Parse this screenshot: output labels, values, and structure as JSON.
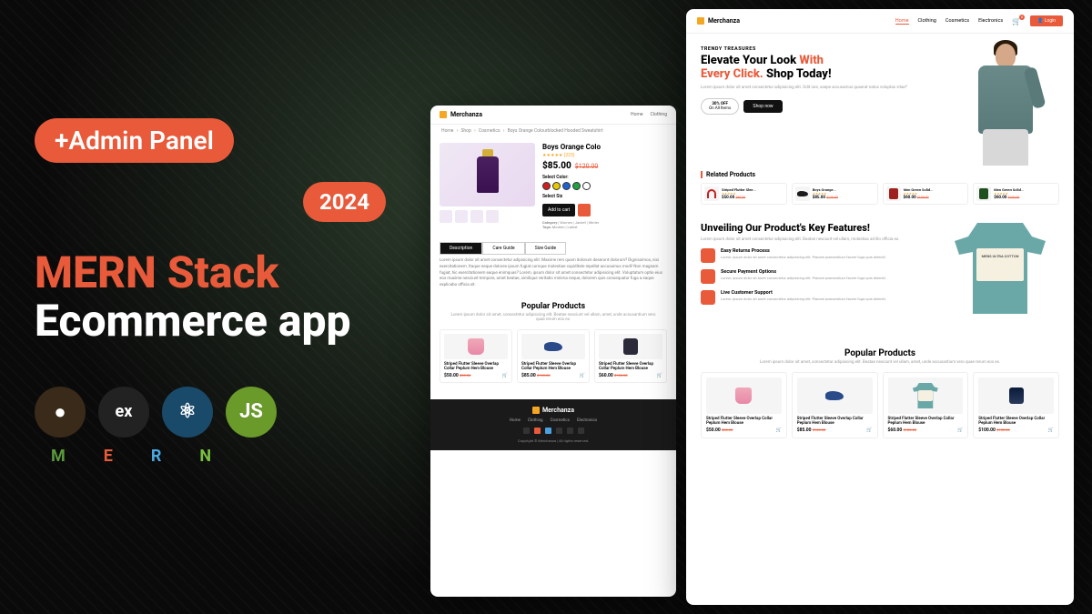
{
  "promo": {
    "admin_badge": "+Admin Panel",
    "year_badge": "2024",
    "title_stack": "MERN Stack",
    "title_app": "Ecommerce app",
    "tech": [
      "M",
      "E",
      "R",
      "N"
    ],
    "tech_labels": {
      "mongo": "",
      "exp": "ex",
      "react": "⚛",
      "node": "JS"
    }
  },
  "brand": "Merchanza",
  "nav_pd": [
    "Home",
    "Clothing"
  ],
  "nav_home": [
    "Home",
    "Clothing",
    "Cosmetics",
    "Electronics"
  ],
  "login_btn": "Login",
  "breadcrumb": [
    "Home",
    "Shop",
    "Cosmetics",
    "Boys Orange Colourblocked Hooded Sweatshirt"
  ],
  "product": {
    "title": "Boys Orange Colo",
    "rating_count": "(223)",
    "price": "$85.00",
    "old_price": "$120.00",
    "select_color": "Select Color:",
    "select_size": "Select Siz",
    "colors": [
      "#d02020",
      "#e6c800",
      "#2060d0",
      "#20a040",
      "#fff"
    ],
    "add_cart": "Add to cart",
    "category_lbl": "Category",
    "category_val": "| Women | Jacket | Winter",
    "tags_lbl": "Tags:",
    "tags_val": "Modern | Latest"
  },
  "tabs": [
    "Description",
    "Care Guide",
    "Size Guide"
  ],
  "description": "Lorem ipsum dolor sit amet consectetur adipisicing elit. Maxime rem quam dolorum deserunt dolorum? Dignissimos, nisi exercitationem. Itaque neque dolores ipsum fugiat cumque molestiae cupiditate repellat accusamus modi! Non magnam fugiat, hic exercitationem eaque enimquas?\nLorem, ipsum dolor sit amet consectetur adipisicing elit. Voluptatum optio eius eos maxime nesciunt tempore, amet beatae, similique veritatis minima neque, dolorem quis consequatur fuga a eaque explicabo officia sit.",
  "popular": {
    "title": "Popular Products",
    "subtitle": "Lorem ipsum dolor sit amet, consectetur adipisicing elit. Beatae nesciunt vel ullam, amet, unde accusantium vero quae rerum eos ex.",
    "items": [
      {
        "name": "Striped Flutter Sleeve Overlap Collar Peplum Hem Blouse",
        "price": "$50.00",
        "old": "$80.00"
      },
      {
        "name": "Striped Flutter Sleeve Overlap Collar Peplum Hem Blouse",
        "price": "$85.00",
        "old": "$120.00"
      },
      {
        "name": "Striped Flutter Sleeve Overlap Collar Peplum Hem Blouse",
        "price": "$60.00",
        "old": "$100.00"
      }
    ]
  },
  "footer": {
    "links": [
      "Home",
      "Clothing",
      "Cosmetics",
      "Electronics"
    ],
    "copyright": "Copyright © Merchanza | All rights reserved."
  },
  "hero": {
    "eyebrow": "TRENDY TREASURES",
    "line1a": "Elevate Your Look ",
    "line1b": "With",
    "line2a": "Every Click. ",
    "line2b": "Shop Today!",
    "subtitle": "Lorem ipsum dolor sit amet consectetur adipisicing elit. Odit iure, saepe accusamus quaerat natus voluptas vitae?",
    "off_pct": "30% OFF",
    "off_txt": "On All Items",
    "shop_btn": "Shop now"
  },
  "related": {
    "title": "Related Products",
    "items": [
      {
        "name": "Striped Flutter Slee...",
        "price": "$50.00",
        "old": "$80.00"
      },
      {
        "name": "Boys Orange...",
        "price": "$85.00",
        "old": "$120.00"
      },
      {
        "name": "Men Green Solid...",
        "price": "$60.00",
        "old": "$100.00"
      },
      {
        "name": "Men Green Solid...",
        "price": "$60.00",
        "old": "$100.00"
      }
    ]
  },
  "features": {
    "title": "Unveiling Our Product's Key Features!",
    "subtitle": "Lorem ipsum dolor sit amet consectetur adipisicing elit. Beatae nesciunt vel ullam, molestias ad illo officia ex.",
    "tshirt_label": "MENS ULTRA COTTON",
    "items": [
      {
        "t": "Easy Returns Process",
        "d": "Lorem, ipsum dolor sit amet consectetur adipisicing elit. Placeat praesentium facere fuga quis deleniti."
      },
      {
        "t": "Secure Payment Options",
        "d": "Lorem, ipsum dolor sit amet consectetur adipisicing elit. Placeat praesentium facere fuga quis deleniti."
      },
      {
        "t": "Live Customer Support",
        "d": "Lorem, ipsum dolor sit amet consectetur adipisicing elit. Placeat praesentium facere fuga quis deleniti."
      }
    ]
  },
  "home_popular": {
    "items": [
      {
        "name": "Striped Flutter Sleeve Overlap Collar Peplum Hem Blouse",
        "price": "$50.00",
        "old": "$80.00"
      },
      {
        "name": "Striped Flutter Sleeve Overlap Collar Peplum Hem Blouse",
        "price": "$85.00",
        "old": "$120.00"
      },
      {
        "name": "Striped Flutter Sleeve Overlap Collar Peplum Hem Blouse",
        "price": "$60.00",
        "old": "$100.00"
      },
      {
        "name": "Striped Flutter Sleeve Overlap Collar Peplum Hem Blouse",
        "price": "$100.00",
        "old": "$150.00"
      }
    ]
  }
}
